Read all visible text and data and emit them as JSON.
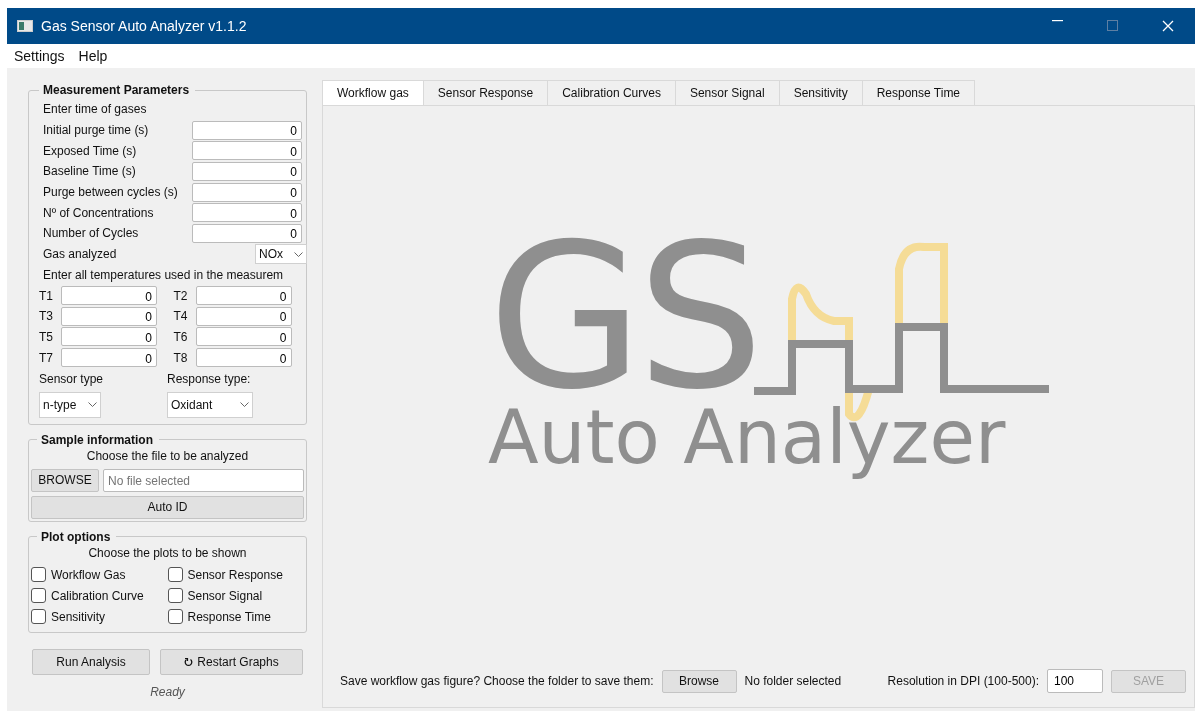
{
  "window": {
    "title": "Gas Sensor Auto Analyzer v1.1.2"
  },
  "menu": [
    "Settings",
    "Help"
  ],
  "measurement": {
    "title": "Measurement Parameters",
    "subtitle": "Enter time of gases",
    "fields": [
      {
        "label": "Initial purge time (s)",
        "value": "0"
      },
      {
        "label": "Exposed Time (s)",
        "value": "0"
      },
      {
        "label": "Baseline Time (s)",
        "value": "0"
      },
      {
        "label": "Purge between cycles (s)",
        "value": "0"
      },
      {
        "label": "Nº of Concentrations",
        "value": "0"
      },
      {
        "label": "Number of Cycles",
        "value": "0"
      }
    ],
    "gas": {
      "label": "Gas analyzed",
      "value": "NOx"
    },
    "temps_label": "Enter all temperatures used in the measurem",
    "temps": [
      {
        "label": "T1",
        "value": "0"
      },
      {
        "label": "T2",
        "value": "0"
      },
      {
        "label": "T3",
        "value": "0"
      },
      {
        "label": "T4",
        "value": "0"
      },
      {
        "label": "T5",
        "value": "0"
      },
      {
        "label": "T6",
        "value": "0"
      },
      {
        "label": "T7",
        "value": "0"
      },
      {
        "label": "T8",
        "value": "0"
      }
    ],
    "sensor_type": {
      "label": "Sensor type",
      "value": "n-type"
    },
    "response_type": {
      "label": "Response type:",
      "value": "Oxidant"
    }
  },
  "sample": {
    "title": "Sample information",
    "subtitle": "Choose the file to be analyzed",
    "browse": "BROWSE",
    "placeholder": "No file selected",
    "auto_id": "Auto ID"
  },
  "plot_options": {
    "title": "Plot options",
    "subtitle": "Choose the plots to be shown",
    "checks": [
      {
        "label": "Workflow Gas",
        "checked": false
      },
      {
        "label": "Sensor Response",
        "checked": false
      },
      {
        "label": "Calibration Curve",
        "checked": false
      },
      {
        "label": "Sensor Signal",
        "checked": false
      },
      {
        "label": "Sensitivity",
        "checked": false
      },
      {
        "label": "Response Time",
        "checked": false
      }
    ]
  },
  "actions": {
    "run": "Run Analysis",
    "restart": "Restart Graphs",
    "status": "Ready"
  },
  "tabs": [
    {
      "label": "Workflow gas",
      "selected": true
    },
    {
      "label": "Sensor Response",
      "selected": false
    },
    {
      "label": "Calibration Curves",
      "selected": false
    },
    {
      "label": "Sensor Signal",
      "selected": false
    },
    {
      "label": "Sensitivity",
      "selected": false
    },
    {
      "label": "Response Time",
      "selected": false
    }
  ],
  "logo": {
    "line1": "GS",
    "line2": "Auto Analyzer"
  },
  "footer": {
    "prompt": "Save workflow gas figure? Choose the folder to save them:",
    "browse": "Browse",
    "folder_status": "No folder selected",
    "dpi_label": "Resolution in DPI (100-500):",
    "dpi_value": "100",
    "save": {
      "label": "SAVE",
      "disabled": true
    }
  }
}
